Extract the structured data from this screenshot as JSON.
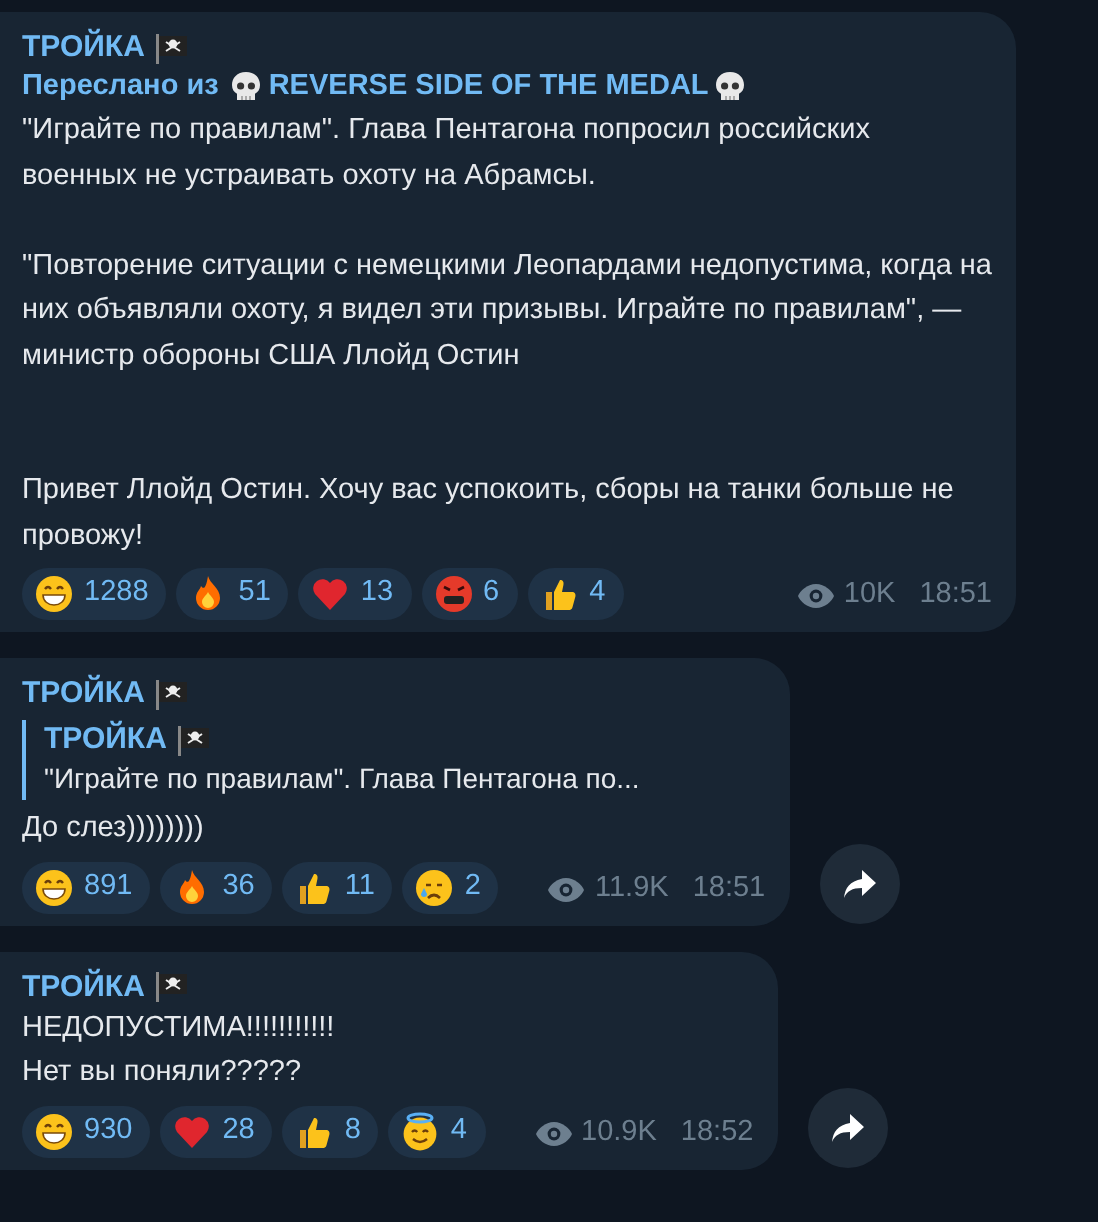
{
  "messages": [
    {
      "author": "ТРОЙКА",
      "forwarded": {
        "prefix": "Переслано из",
        "source": "REVERSE SIDE OF THE MEDAL"
      },
      "text": "\"Играйте по правилам\". Глава Пентагона попросил российских военных не устраивать охоту на Абрамсы.\n\n\"Повторение ситуации с немецкими Леопардами недопустима, когда на них объявляли охоту, я видел эти призывы. Играйте по правилам\", — министр обороны США Ллойд Остин\n\n\nПривет Ллойд Остин. Хочу вас успокоить, сборы на танки больше не провожу!",
      "reactions": [
        {
          "kind": "grin",
          "count": "1288"
        },
        {
          "kind": "fire",
          "count": "51"
        },
        {
          "kind": "heart",
          "count": "13"
        },
        {
          "kind": "angry",
          "count": "6"
        },
        {
          "kind": "thumbs",
          "count": "4"
        }
      ],
      "views": "10K",
      "time": "18:51",
      "share_button": false
    },
    {
      "author": "ТРОЙКА",
      "reply": {
        "author": "ТРОЙКА",
        "text": "\"Играйте по правилам\". Глава Пентагона по..."
      },
      "text": "До слез))))))))",
      "reactions": [
        {
          "kind": "grin",
          "count": "891"
        },
        {
          "kind": "fire",
          "count": "36"
        },
        {
          "kind": "thumbs",
          "count": "11"
        },
        {
          "kind": "cry",
          "count": "2"
        }
      ],
      "views": "11.9K",
      "time": "18:51",
      "share_button": true
    },
    {
      "author": "ТРОЙКА",
      "text": "НЕДОПУСТИМА!!!!!!!!!!!\nНет вы поняли?????",
      "reactions": [
        {
          "kind": "grin",
          "count": "930"
        },
        {
          "kind": "heart",
          "count": "28"
        },
        {
          "kind": "thumbs",
          "count": "8"
        },
        {
          "kind": "halo",
          "count": "4"
        }
      ],
      "views": "10.9K",
      "time": "18:52",
      "share_button": true
    }
  ]
}
